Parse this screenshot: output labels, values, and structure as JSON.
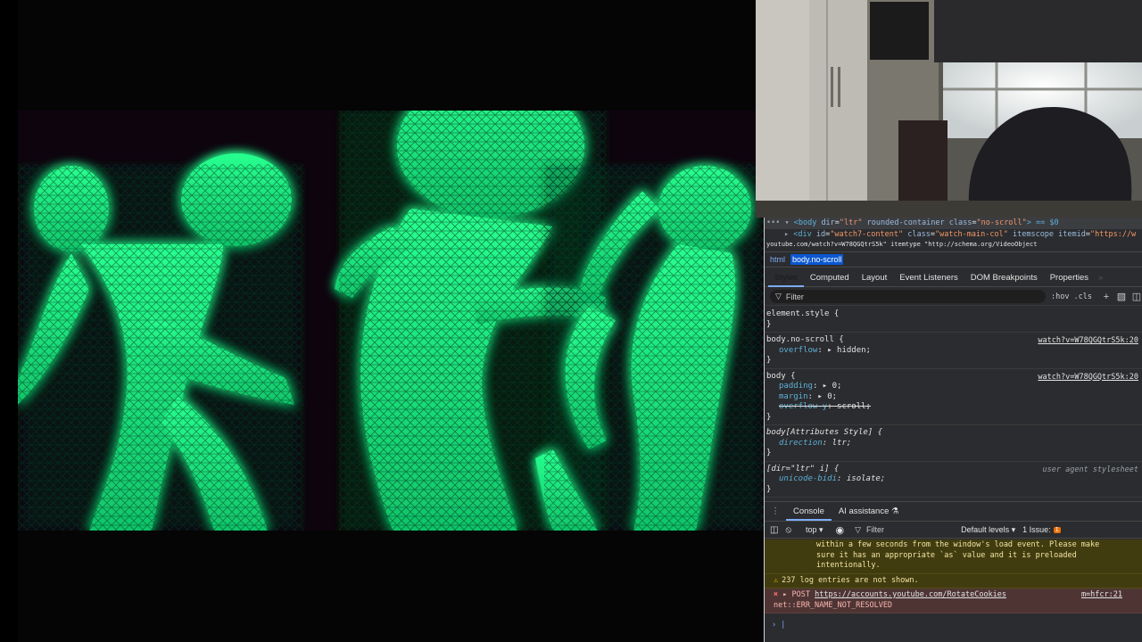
{
  "devtools": {
    "dom": {
      "line1": {
        "prefix": "••• ▾",
        "tag_open": "<body",
        "a1": "dir",
        "v1": "\"ltr\"",
        "a2": "rounded-container",
        "a3": "class",
        "v3": "\"no-scroll\"",
        "suffix": "> == $0"
      },
      "line2": {
        "prefix": "▸",
        "tag_open": "<div",
        "a1": "id",
        "v1": "\"watch7-content\"",
        "a2": "class",
        "v2": "\"watch-main-col\"",
        "a3": "itemscope itemid",
        "v3": "\"https://w"
      },
      "line3": {
        "text": "    youtube.com/watch?v=W78QGQtrS5k\" itemtype \"http://schema.org/VideoObject"
      }
    },
    "breadcrumbs": [
      "html",
      "body.no-scroll"
    ],
    "tabs": [
      "Styles",
      "Computed",
      "Layout",
      "Event Listeners",
      "DOM Breakpoints",
      "Properties"
    ],
    "tabs_more": "»",
    "filter": {
      "placeholder": "Filter",
      "hov": ":hov",
      "cls": ".cls"
    },
    "styles": {
      "element_style": {
        "selector": "element.style {",
        "close": "}"
      },
      "rule1": {
        "selector": "body.no-scroll {",
        "source": "watch?v=W78QGQtrS5k:20",
        "prop": "overflow",
        "value": "▸ hidden;",
        "close": "}"
      },
      "rule2": {
        "selector": "body {",
        "source": "watch?v=W78QGQtrS5k:20",
        "p1": "padding",
        "v1": "▸ 0;",
        "p2": "margin",
        "v2": "▸ 0;",
        "p3": "overflow-y",
        "v3": "scroll;",
        "close": "}"
      },
      "rule3": {
        "selector": "body[Attributes Style] {",
        "prop": "direction",
        "value": "ltr;",
        "close": "}"
      },
      "rule4": {
        "selector": "[dir=\"ltr\" i] {",
        "source": "user agent stylesheet",
        "prop": "unicode-bidi",
        "value": "isolate;",
        "close": "}"
      }
    },
    "drawer": {
      "kebab": "⋮",
      "tabs": [
        "Console",
        "AI assistance"
      ],
      "ai_icon": "⚗"
    },
    "console_bar": {
      "context": "top ▾",
      "filter": "Filter",
      "levels": "Default levels ▾",
      "issues": "1 Issue:",
      "issue_count": "1"
    },
    "console": {
      "warn_text_1": "within a few seconds from the window's load event. Please make",
      "warn_text_2": "sure it has an appropriate `as` value and it is preloaded",
      "warn_text_3": "intentionally.",
      "hidden_entries": "237 log entries are not shown.",
      "err_prefix": "▸ POST",
      "err_url": "https://accounts.youtube.com/RotateCookies",
      "err_source": "m=hfcr:21",
      "err_text": "net::ERR_NAME_NOT_RESOLVED",
      "prompt": "› |"
    }
  },
  "colors": {
    "glow": "#00ff88",
    "video_bg": "#0d040e",
    "devtools_bg": "#2b2c2f",
    "accent": "#7cacf8"
  }
}
